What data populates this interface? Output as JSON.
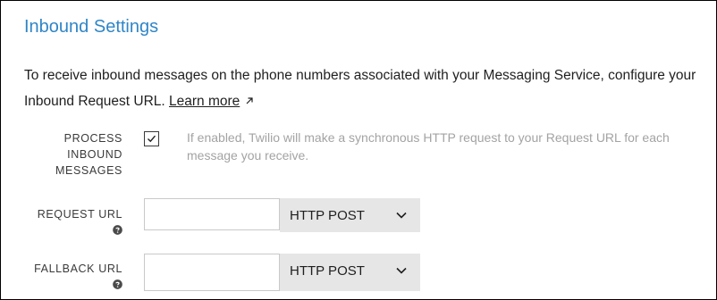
{
  "section": {
    "title": "Inbound Settings",
    "description": "To receive inbound messages on the phone numbers associated with your Messaging Service, configure your Inbound Request URL.",
    "learn_more": "Learn more",
    "learn_more_icon": "external-link-arrow-icon"
  },
  "process_inbound": {
    "label": "PROCESS INBOUND MESSAGES",
    "checked": true,
    "hint": "If enabled, Twilio will make a synchronous HTTP request to your Request URL for each message you receive."
  },
  "request_url": {
    "label": "REQUEST URL",
    "value": "",
    "method": "HTTP POST",
    "help_icon": "question-circle-icon"
  },
  "fallback_url": {
    "label": "FALLBACK URL",
    "value": "",
    "method": "HTTP POST",
    "help_icon": "question-circle-icon"
  },
  "colors": {
    "title": "#2f86c7",
    "hint": "#a3a3a3",
    "select_bg": "#e6e6e6"
  }
}
